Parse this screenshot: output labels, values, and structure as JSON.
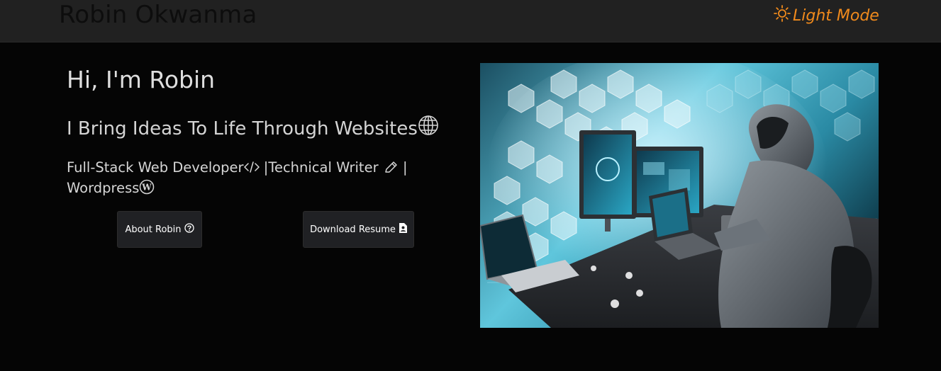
{
  "navbar": {
    "brand": "Robin Okwanma",
    "mode_toggle_label": "Light Mode",
    "mode_toggle_icon": "sun-icon"
  },
  "hero": {
    "greeting": "Hi, I'm Robin",
    "tagline": "I Bring Ideas To Life Through Websites",
    "tagline_icon": "globe-icon",
    "roles": {
      "part1": "Full-Stack Web Developer",
      "part2": " |Technical Writer ",
      "part3": " | Wordpress"
    }
  },
  "buttons": {
    "about_label": "About Robin",
    "about_icon": "question-circle-icon",
    "resume_label": "Download Resume",
    "resume_icon": "file-person-icon"
  },
  "image": {
    "subject": "hooded-person-at-computer-illustration"
  },
  "colors": {
    "background": "#050505",
    "navbar": "#212121",
    "accent": "#f08a1c",
    "button_bg": "#202124",
    "text": "#dedede"
  }
}
